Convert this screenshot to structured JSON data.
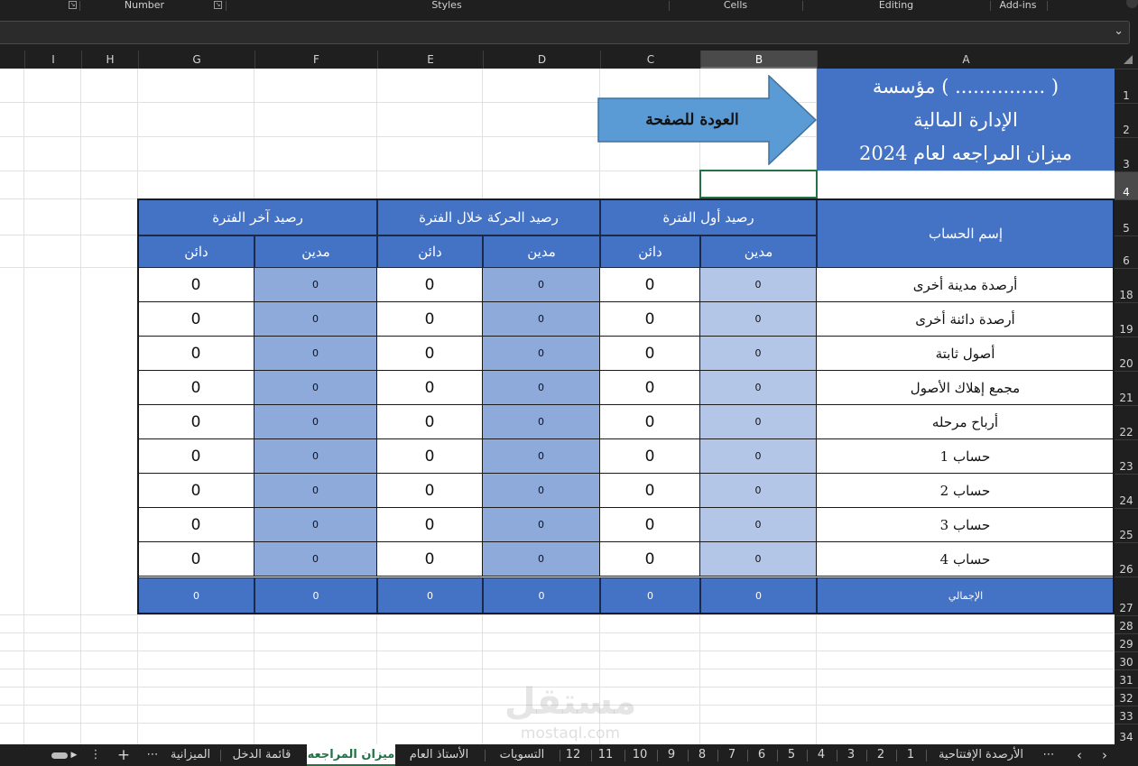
{
  "ribbon": {
    "groups": [
      "Number",
      "Styles",
      "Cells",
      "Editing",
      "Add-ins"
    ]
  },
  "columns": [
    "I",
    "H",
    "G",
    "F",
    "E",
    "D",
    "C",
    "B",
    "A"
  ],
  "active_column": "B",
  "rows": [
    "1",
    "2",
    "3",
    "4",
    "5",
    "6",
    "18",
    "19",
    "20",
    "21",
    "22",
    "23",
    "24",
    "25",
    "26",
    "27",
    "28",
    "29",
    "30",
    "31",
    "32",
    "33",
    "34"
  ],
  "active_row": "4",
  "title": {
    "line1": "مؤسسة ( ............... )",
    "line2": "الإدارة المالية",
    "line3": "ميزان المراجعه لعام 2024"
  },
  "back_button": {
    "label": "العودة للصفحة"
  },
  "table": {
    "account_name_header": "إسم الحساب",
    "groups": [
      "رصيد أول الفترة",
      "رصيد الحركة خلال الفترة",
      "رصيد آخر الفترة"
    ],
    "debit_label": "مدين",
    "credit_label": "دائن",
    "rows": [
      {
        "name": "أرصدة مدينة أخرى",
        "values": [
          "0",
          "0",
          "0",
          "0",
          "0",
          "0"
        ]
      },
      {
        "name": "أرصدة دائنة أخرى",
        "values": [
          "0",
          "0",
          "0",
          "0",
          "0",
          "0"
        ]
      },
      {
        "name": "أصول ثابتة",
        "values": [
          "0",
          "0",
          "0",
          "0",
          "0",
          "0"
        ]
      },
      {
        "name": "مجمع إهلاك الأصول",
        "values": [
          "0",
          "0",
          "0",
          "0",
          "0",
          "0"
        ]
      },
      {
        "name": "أرباح مرحله",
        "values": [
          "0",
          "0",
          "0",
          "0",
          "0",
          "0"
        ]
      },
      {
        "name": "حساب 1",
        "values": [
          "0",
          "0",
          "0",
          "0",
          "0",
          "0"
        ]
      },
      {
        "name": "حساب 2",
        "values": [
          "0",
          "0",
          "0",
          "0",
          "0",
          "0"
        ]
      },
      {
        "name": "حساب 3",
        "values": [
          "0",
          "0",
          "0",
          "0",
          "0",
          "0"
        ]
      },
      {
        "name": "حساب 4",
        "values": [
          "0",
          "0",
          "0",
          "0",
          "0",
          "0"
        ]
      }
    ],
    "total": {
      "name": "الإجمالي",
      "values": [
        "0",
        "0",
        "0",
        "0",
        "0",
        "0"
      ]
    }
  },
  "watermark": {
    "text": "مستقل",
    "domain": "mostaql.com"
  },
  "sheet_tabs": {
    "items": [
      "الأرصدة الإفتتاحية",
      "1",
      "2",
      "3",
      "4",
      "5",
      "6",
      "7",
      "8",
      "9",
      "10",
      "11",
      "12",
      "التسويات",
      "الأستاذ العام",
      "ميزان المراجعه",
      "قائمة الدخل",
      "الميزانية"
    ],
    "active": "ميزان المراجعه",
    "add_label": "+",
    "more_label": "⋯"
  },
  "colors": {
    "header_blue": "#4472c4",
    "light_blue": "#b4c6e7",
    "mid_blue": "#8eaadb",
    "arrow_blue": "#5b9bd5",
    "selection_green": "#217346"
  }
}
